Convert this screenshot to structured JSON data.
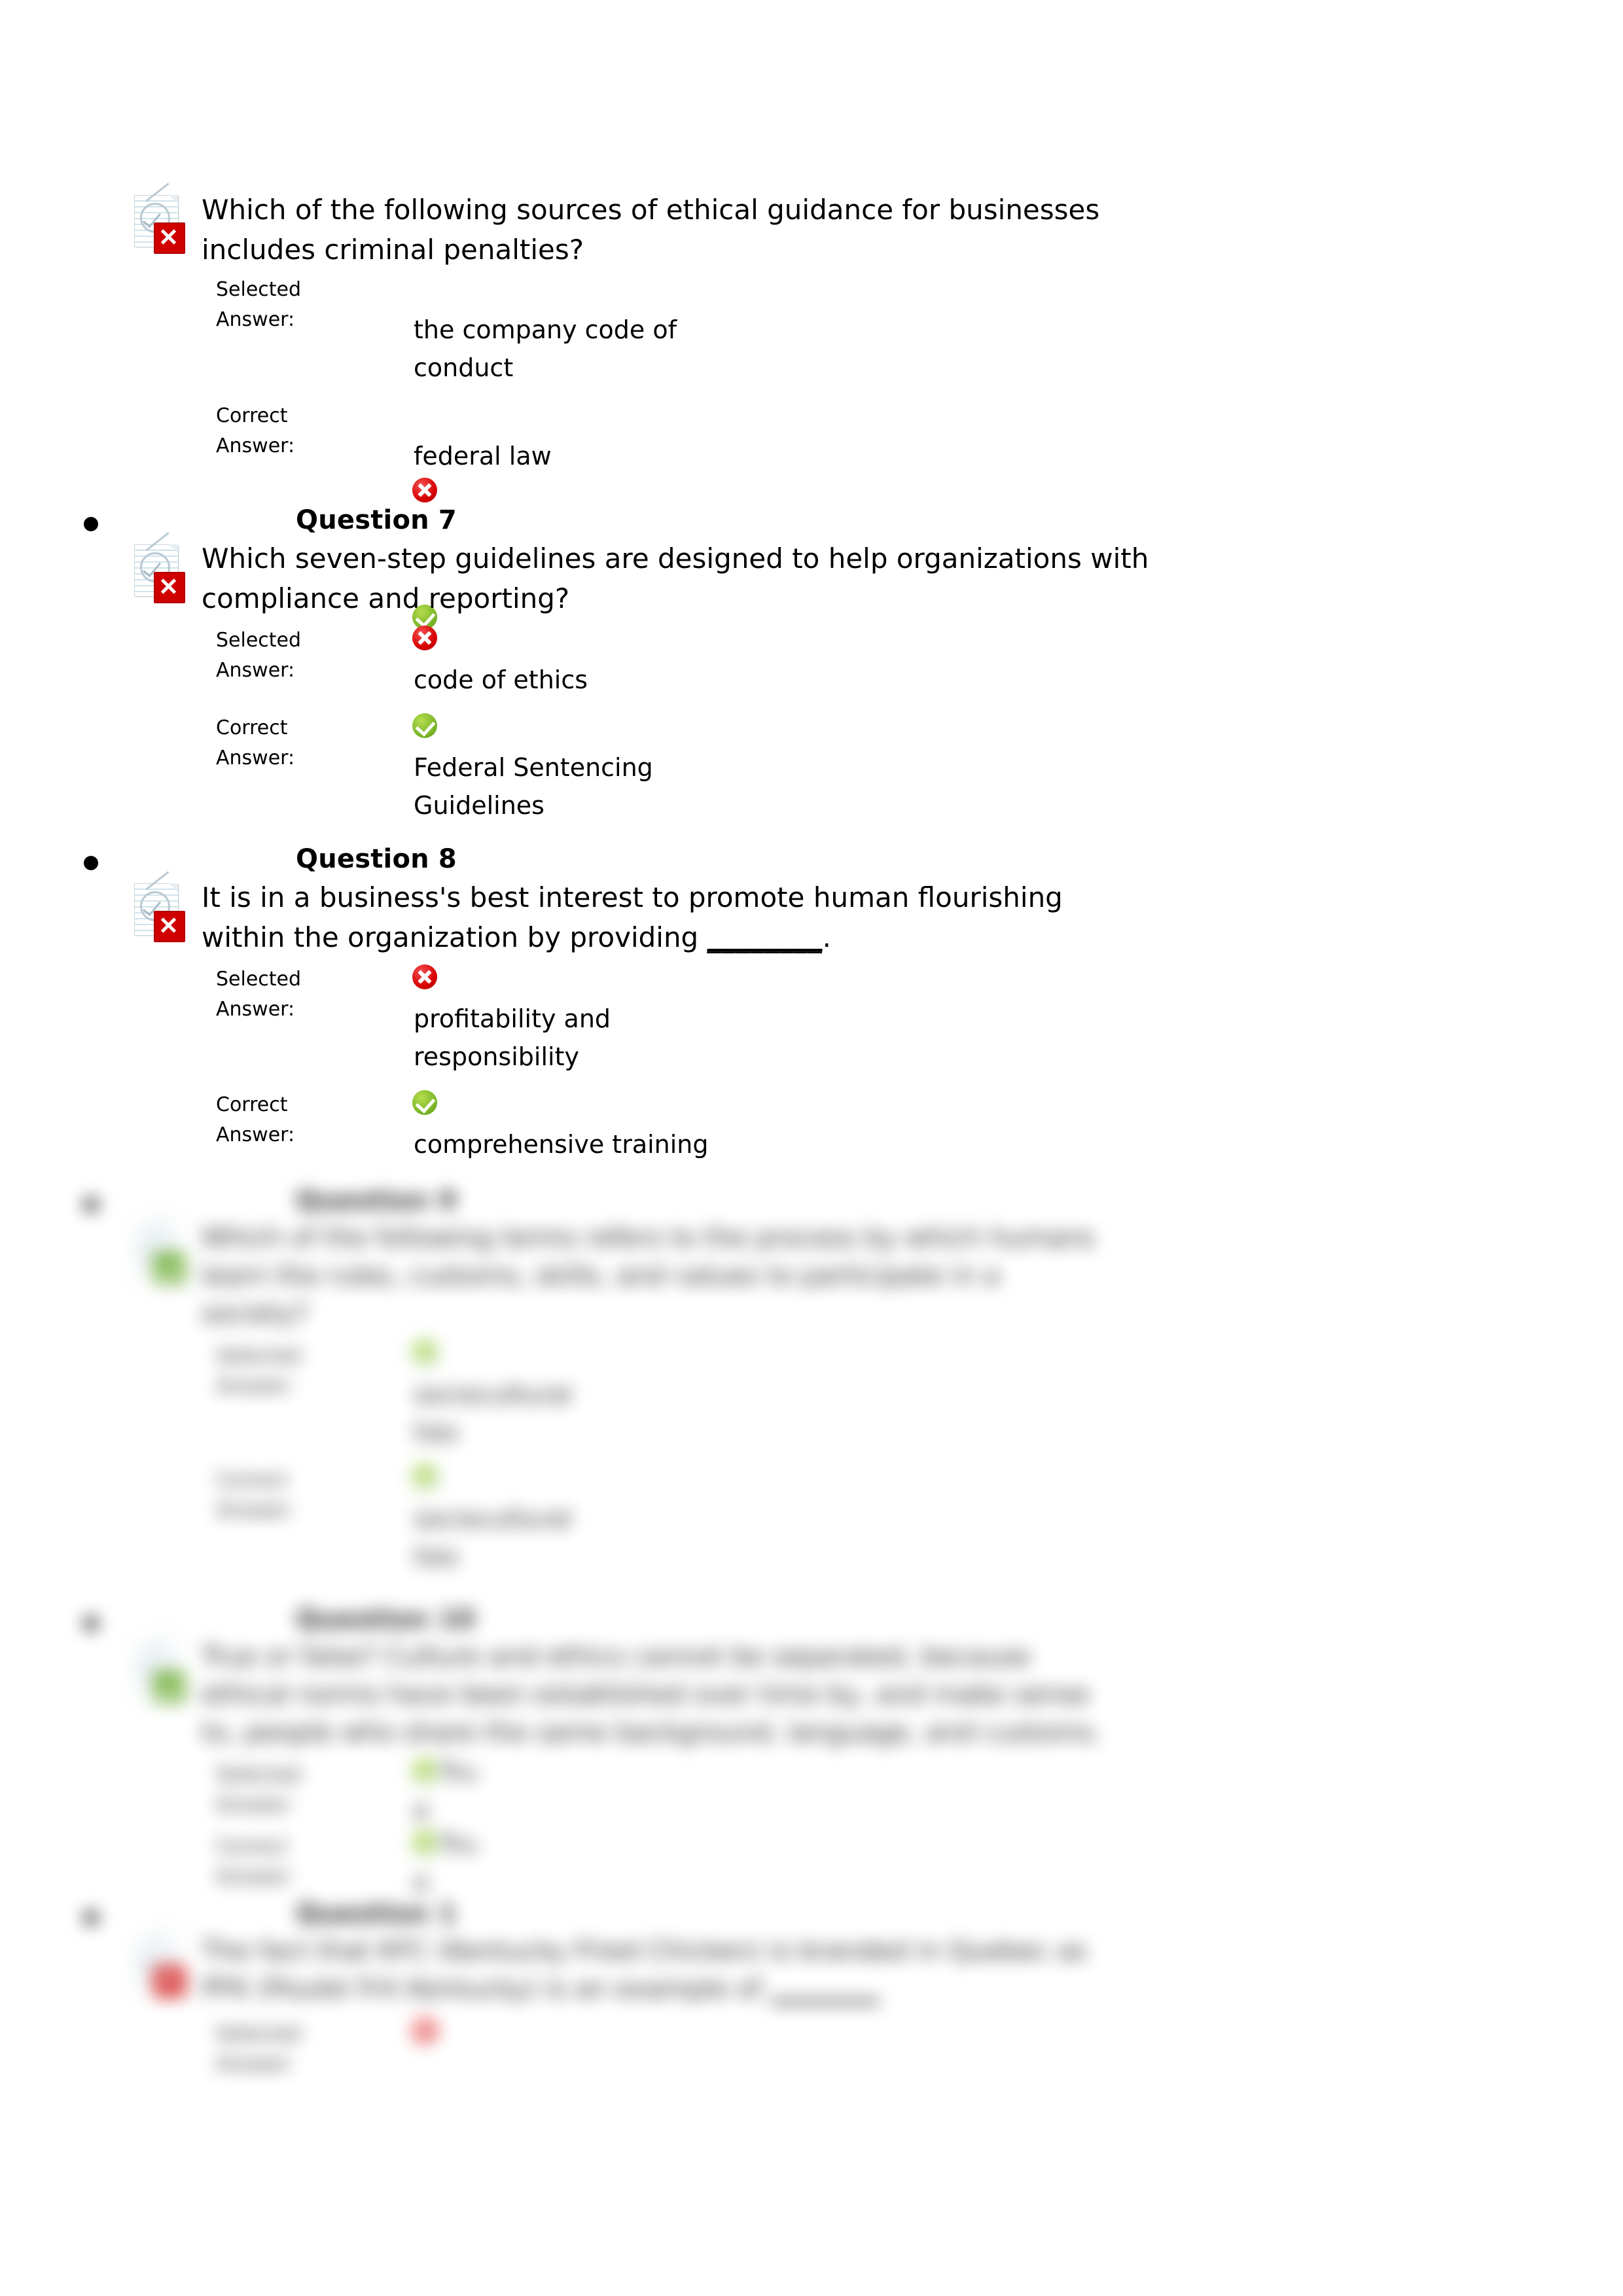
{
  "document": {
    "page_background": "#ffffff",
    "colors": {
      "incorrect": "#d60000",
      "correct": "#7db82a",
      "text": "#000000"
    }
  },
  "labels": {
    "selected_answer": "Selected Answer:",
    "selected_answer_line1": "Selected",
    "selected_answer_line2": "Answer:",
    "correct_answer_line1": "Correct",
    "correct_answer_line2": "Answer:"
  },
  "questions": [
    {
      "title": "",
      "show_title": false,
      "status": "incorrect",
      "text_line1": "Which of the following sources of ethical guidance for businesses",
      "text_line2": "includes criminal penalties?",
      "selected": {
        "mark": "incorrect",
        "line1": "the company code of",
        "line2": "conduct"
      },
      "correct": {
        "mark": "correct",
        "line1": "federal law",
        "line2": ""
      }
    },
    {
      "title": "Question 7",
      "show_title": true,
      "status": "incorrect",
      "text_line1": "Which seven-step guidelines are designed to help organizations with",
      "text_line2": "compliance and reporting?",
      "selected": {
        "mark": "incorrect",
        "line1": "code of ethics",
        "line2": ""
      },
      "correct": {
        "mark": "correct",
        "line1": "Federal Sentencing",
        "line2": "Guidelines"
      }
    },
    {
      "title": "Question 8",
      "show_title": true,
      "status": "incorrect",
      "text_line1": "It is in a business's best interest to promote human flourishing",
      "text_line2_pre": "within the organization by providing ",
      "text_line2_blank": "________",
      "text_line2_post": ".",
      "selected": {
        "mark": "incorrect",
        "line1": "profitability and",
        "line2": "responsibility"
      },
      "correct": {
        "mark": "correct",
        "line1": "comprehensive training",
        "line2": ""
      }
    }
  ],
  "blurred_questions": [
    {
      "title": "Question 9",
      "status": "correct",
      "text_line1": "Which of the following terms refers to the process by which humans",
      "text_line2": "learn the rules, customs, skills, and values to participate in a",
      "text_line3": "society?",
      "selected": {
        "mark": "correct",
        "line1": "sociocultural",
        "line2": "ties"
      },
      "correct": {
        "mark": "correct",
        "line1": "sociocultural",
        "line2": "ties"
      }
    },
    {
      "title": "Question 10",
      "status": "correct",
      "text_line1": "True or false? Culture and ethics cannot be separated, because",
      "text_line2": "ethical norms have been established over time by, and make sense",
      "text_line3": "to, people who share the same background, language, and customs.",
      "selected": {
        "mark": "correct",
        "line1": "Tru",
        "line2": "e"
      },
      "correct": {
        "mark": "correct",
        "line1": "Tru",
        "line2": "e"
      }
    },
    {
      "title": "Question 1",
      "status": "incorrect",
      "text_line1": "The fact that KFC (Kentucky Fried Chicken) is branded in Quebec as",
      "text_line2_pre": "PFK (Poulet Frit Kentucky) is an example of ",
      "text_line2_blank": "________",
      "text_line3": "",
      "selected": {
        "mark": "incorrect",
        "line1": "",
        "line2": ""
      }
    }
  ]
}
